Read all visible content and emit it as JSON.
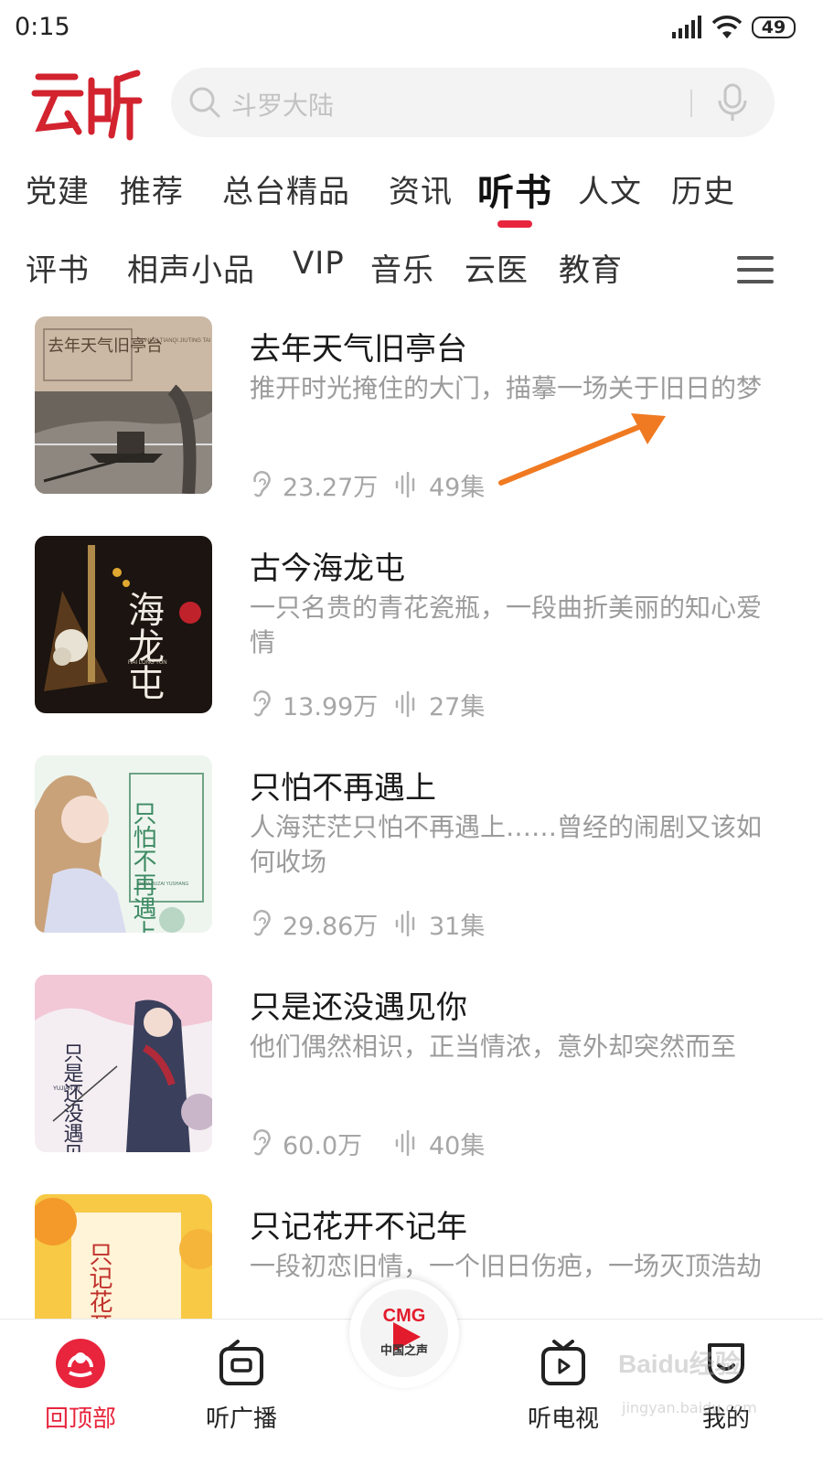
{
  "status_bar": {
    "time": "0:15",
    "battery": "49"
  },
  "header": {
    "logo_text": "云听",
    "search_placeholder": "斗罗大陆"
  },
  "tabs_row1": [
    "党建",
    "推荐",
    "总台精品",
    "资讯",
    "听书",
    "人文",
    "历史"
  ],
  "tabs_row2": [
    "评书",
    "相声小品",
    "VIP",
    "音乐",
    "云医",
    "教育"
  ],
  "active_tab": "听书",
  "books": [
    {
      "title": "去年天气旧亭台",
      "desc": "推开时光掩住的大门，描摹一场关于旧日的梦",
      "plays": "23.27万",
      "episodes": "49集",
      "cover_text": "去年天气旧亭台",
      "cover_pinyin": "QUNIAN TIANQI JIUTING TAI",
      "cover_colors": [
        "#cbb9a6",
        "#6b645c"
      ]
    },
    {
      "title": "古今海龙屯",
      "desc": "一只名贵的青花瓷瓶，一段曲折美丽的知心爱情",
      "plays": "13.99万",
      "episodes": "27集",
      "cover_text": "海龙屯",
      "cover_pinyin": "HAI LONG TUN",
      "cover_colors": [
        "#1b1410",
        "#5a3a1c"
      ]
    },
    {
      "title": "只怕不再遇上",
      "desc": "人海茫茫只怕不再遇上……曾经的闹剧又该如何收场",
      "plays": "29.86万",
      "episodes": "31集",
      "cover_text": "只怕不再遇上",
      "cover_pinyin": "ZHIPA BUZAI YUSHANG",
      "cover_colors": [
        "#eef5ee",
        "#b9d6c4"
      ]
    },
    {
      "title": "只是还没遇见你",
      "desc": "他们偶然相识，正当情浓，意外却突然而至",
      "plays": "60.0万",
      "episodes": "40集",
      "cover_text": "只是还没遇见你",
      "cover_pinyin": "YUJIAN NI",
      "cover_colors": [
        "#f4eef2",
        "#c9b6c8"
      ]
    },
    {
      "title": "只记花开不记年",
      "desc": "一段初恋旧情，一个旧日伤疤，一场灭顶浩劫",
      "plays": "",
      "episodes": "",
      "cover_text": "只记花开不记年",
      "cover_pinyin": "",
      "cover_colors": [
        "#f7c945",
        "#fff3d8"
      ]
    }
  ],
  "bottom_nav": {
    "items": [
      "回顶部",
      "听广播",
      "",
      "听电视",
      "我的"
    ],
    "center_logo": "CMG",
    "center_sub": "中国之声"
  },
  "watermark": {
    "main": "Baidu经验",
    "sub": "jingyan.baidu.com"
  },
  "colors": {
    "accent": "#e8253d",
    "annotation": "#f07a22"
  }
}
